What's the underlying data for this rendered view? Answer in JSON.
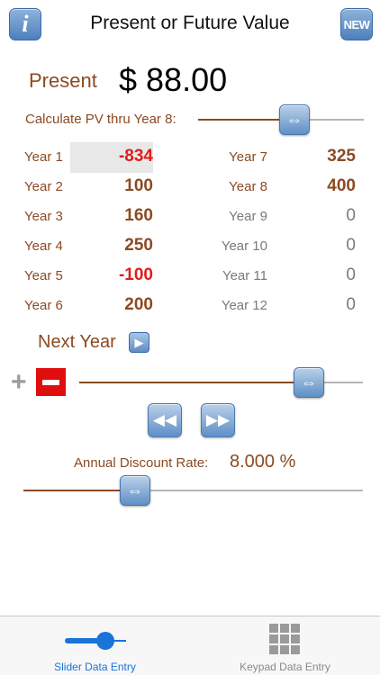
{
  "header": {
    "info_label": "i",
    "title": "Present or Future Value",
    "new_label": "NEW"
  },
  "present": {
    "label": "Present",
    "value": "$ 88.00"
  },
  "calc": {
    "label": "Calculate PV thru Year 8:",
    "slider_fraction": 0.58
  },
  "years": [
    {
      "label": "Year 1",
      "value": "-834",
      "style": "neg"
    },
    {
      "label": "Year 2",
      "value": "100",
      "style": "pos"
    },
    {
      "label": "Year 3",
      "value": "160",
      "style": "pos"
    },
    {
      "label": "Year 4",
      "value": "250",
      "style": "pos"
    },
    {
      "label": "Year 5",
      "value": "-100",
      "style": "neg"
    },
    {
      "label": "Year 6",
      "value": "200",
      "style": "pos"
    },
    {
      "label": "Year 7",
      "value": "325",
      "style": "pos"
    },
    {
      "label": "Year 8",
      "value": "400",
      "style": "pos"
    },
    {
      "label": "Year 9",
      "value": "0",
      "style": "zero"
    },
    {
      "label": "Year 10",
      "value": "0",
      "style": "zero"
    },
    {
      "label": "Year 11",
      "value": "0",
      "style": "zero"
    },
    {
      "label": "Year 12",
      "value": "0",
      "style": "zero"
    }
  ],
  "next_year": {
    "label": "Next Year",
    "arrow": "▶"
  },
  "amount": {
    "plus": "+",
    "slider_fraction": 0.81
  },
  "nav": {
    "prev": "◀◀",
    "next": "▶▶"
  },
  "rate": {
    "label": "Annual Discount Rate:",
    "value": "8.000 %",
    "slider_fraction": 0.33
  },
  "tabs": [
    {
      "label": "Slider Data Entry",
      "icon": "slider-icon",
      "active": true
    },
    {
      "label": "Keypad Data Entry",
      "icon": "keypad-grid-icon",
      "active": false
    }
  ],
  "colors": {
    "brown": "#8b4a22",
    "negative": "#e21c1c",
    "zero": "#7a7a7a",
    "accent": "#1a73d9"
  }
}
